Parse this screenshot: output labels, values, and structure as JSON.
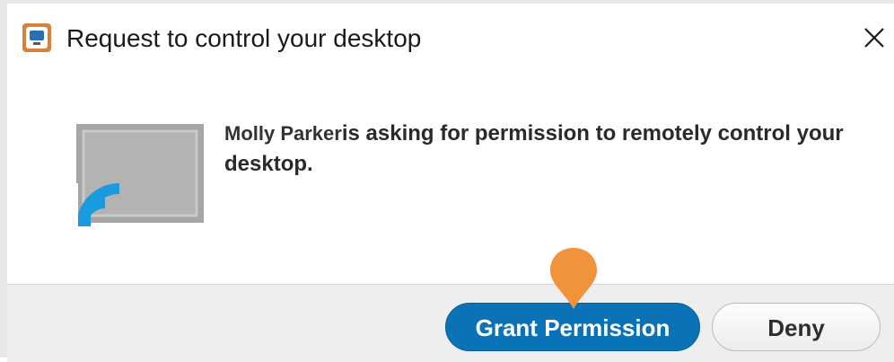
{
  "window": {
    "title": "Request to control your desktop",
    "icons": {
      "app": "app-icon",
      "close": "close-icon"
    }
  },
  "content": {
    "requester_name": "Molly Parker",
    "message": "is asking for permission to remotely control your desktop.",
    "illustration_icon": "screen-share-icon"
  },
  "buttons": {
    "grant_label": "Grant Permission",
    "deny_label": "Deny"
  },
  "colors": {
    "primary": "#0a72b6",
    "wave": "#1a9be0",
    "screen": "#a9a9a9",
    "marker": "#f0933a"
  }
}
